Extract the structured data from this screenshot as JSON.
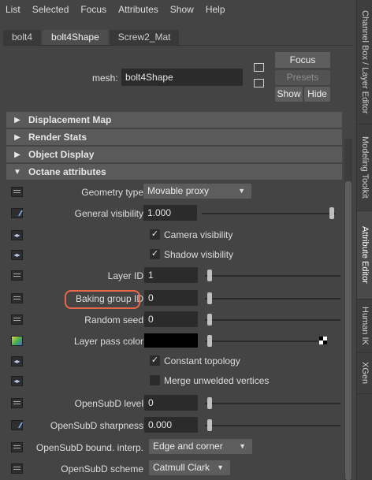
{
  "menu": [
    "List",
    "Selected",
    "Focus",
    "Attributes",
    "Show",
    "Help"
  ],
  "tabs": [
    "bolt4",
    "bolt4Shape",
    "Screw2_Mat"
  ],
  "mesh": {
    "label": "mesh:",
    "value": "bolt4Shape"
  },
  "buttons": {
    "focus": "Focus",
    "presets": "Presets",
    "show": "Show",
    "hide": "Hide"
  },
  "sections": [
    {
      "label": "Displacement Map",
      "expanded": false
    },
    {
      "label": "Render Stats",
      "expanded": false
    },
    {
      "label": "Object Display",
      "expanded": false
    },
    {
      "label": "Octane attributes",
      "expanded": true
    }
  ],
  "attrs": {
    "geometry_type": {
      "label": "Geometry type",
      "value": "Movable proxy"
    },
    "general_visibility": {
      "label": "General visibility",
      "value": "1.000",
      "level": 1.0
    },
    "camera_visibility": {
      "label": "Camera visibility",
      "checked": true
    },
    "shadow_visibility": {
      "label": "Shadow visibility",
      "checked": true
    },
    "layer_id": {
      "label": "Layer ID",
      "value": "1"
    },
    "baking_group_id": {
      "label": "Baking group ID",
      "value": "0"
    },
    "random_seed": {
      "label": "Random seed",
      "value": "0"
    },
    "layer_pass_color": {
      "label": "Layer pass color",
      "color": "#000000"
    },
    "constant_topology": {
      "label": "Constant topology",
      "checked": true
    },
    "merge_unwelded": {
      "label": "Merge unwelded vertices",
      "checked": false
    },
    "opensubd_level": {
      "label": "OpenSubD level",
      "value": "0"
    },
    "opensubd_sharpness": {
      "label": "OpenSubD sharpness",
      "value": "0.000"
    },
    "opensubd_bound": {
      "label": "OpenSubD bound. interp.",
      "value": "Edge and corner"
    },
    "opensubd_scheme": {
      "label": "OpenSubD scheme",
      "value": "Catmull Clark"
    }
  },
  "side_tabs": [
    "Channel Box / Layer Editor",
    "Modeling Toolkit",
    "Attribute Editor",
    "Human IK",
    "XGen"
  ],
  "colors": {
    "highlight": "#e8664a",
    "panel": "#444444",
    "field": "#2b2b2b"
  }
}
